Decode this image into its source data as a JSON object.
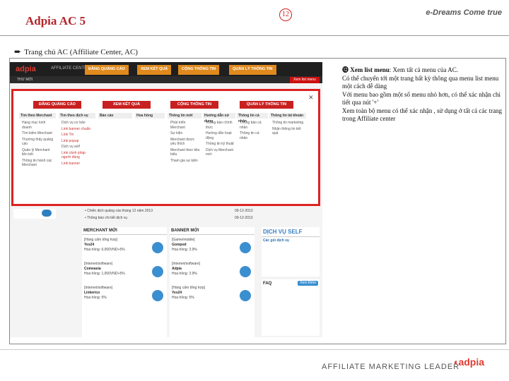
{
  "slide": {
    "title": "Adpia AC 5",
    "brand": "e-Dreams Come true",
    "bullet": "Trang chủ AC (Affiliate Center, AC)",
    "badge": "12",
    "footer_tagline": "AFFILIATE MARKETING LEADER",
    "footer_logo": "adpia"
  },
  "description": {
    "lead": "Xem list menu",
    "lines": [
      ": Xem tất cả menu của AC.",
      "Có thể chuyển tới một trang bất kỳ thông qua menu list menu một cách dễ dàng",
      "Với menu bao gồm một số menu nhỏ hơn, có thể xác nhận chi tiết qua nút '+'",
      "Xem toàn bộ menu có thể xác nhận , sử dụng ở tất cả các trang trong Affiliate center"
    ]
  },
  "screenshot": {
    "logo": "adpia",
    "logo_sub": "AFFILIATE CENTER",
    "top_nav": [
      "ĐĂNG QUẢNG CÁO",
      "XEM KẾT QUẢ",
      "CỘNG THÔNG TIN",
      "QUẢN LÝ THÔNG TIN"
    ],
    "breadcrumb": "THƯ MỚI",
    "list_menu_button": "Xem list menu",
    "menu": {
      "buttons": [
        "ĐĂNG QUẢNG CÁO",
        "XEM KẾT QUẢ",
        "CỘNG THÔNG TIN",
        "QUẢN LÝ THÔNG TIN"
      ],
      "columns": [
        {
          "head": "Tìm theo Merchant",
          "items": [
            "Hạng mục kinh doanh",
            "Tìm kiếm Merchant",
            "Thường thấy quảng cáo",
            "Quản lý Merchant liên kết",
            "Thông tin hành các Merchant"
          ]
        },
        {
          "head": "Tìm theo dịch vụ",
          "items": [
            "Dịch vụ cơ bản",
            "Link banner chuẩn",
            "Link Tin",
            "Link popup",
            "Dịch vụ self",
            "Link cảnh pháp người dùng",
            "Link banner"
          ],
          "red": true
        },
        {
          "head": "Báo cáo",
          "items": []
        },
        {
          "head": "Hoa hồng",
          "items": []
        },
        {
          "head": "Thông tin mới",
          "items": [
            "Phát triển Merchant",
            "Sự kiện",
            "Merchant được yêu thích",
            "Merchant theo tiêu biểu",
            "Tham gia sự kiện"
          ]
        },
        {
          "head": "Hướng dẫn sử dụng",
          "items": [
            "Thông báo chính thức",
            "Hướng dẫn hoạt động",
            "Thông tin kỹ thuật",
            "Dịch vụ Merchant mới"
          ]
        },
        {
          "head": "Thông tin cá nhân",
          "items": [
            "Thông báo cá nhân",
            "Thông tin cá nhân"
          ]
        },
        {
          "head": "Thông tin tài khoản",
          "items": [
            "Thông tin marketing",
            "Nhận thông tin kết quả"
          ]
        }
      ]
    },
    "lower": {
      "merchant_title": "MERCHANT MỚI",
      "merchant_items": [
        {
          "cat": "[Hàng cấm tổng hợp]",
          "name": "Yes24",
          "rate": "Hoa hồng: 6,000VND+5%"
        },
        {
          "cat": "[Internet/software]",
          "name": "Comeasia",
          "rate": "Hoa hồng: 1,000VND+5%"
        },
        {
          "cat": "[Internet/software]",
          "name": "Linkerico",
          "rate": "Hoa hồng: 5%"
        }
      ],
      "banner_title": "BANNER MỚI",
      "banner_items": [
        {
          "cat": "[Game/mobile]",
          "name": "Gompod",
          "rate": "Hoa hồng: 3.9%"
        },
        {
          "cat": "[Internet/software]",
          "name": "Adpia",
          "rate": "Hoa hồng: 3.9%"
        },
        {
          "cat": "[Hàng cấm tổng hợp]",
          "name": "Yes24",
          "rate": "Hoa hồng: 5%"
        }
      ],
      "notice": "Chiến dịch quảng cáo tháng 12 năm 2013",
      "notice2": "Thông báo chi tiết dịch vụ",
      "dates": [
        "09-12-2013",
        "09-12-2013"
      ],
      "self_title": "DỊCH VỤ SELF",
      "self_sub": "Các gói dịch vụ",
      "faq_title": "FAQ",
      "faq_button": "Xem thêm"
    }
  }
}
